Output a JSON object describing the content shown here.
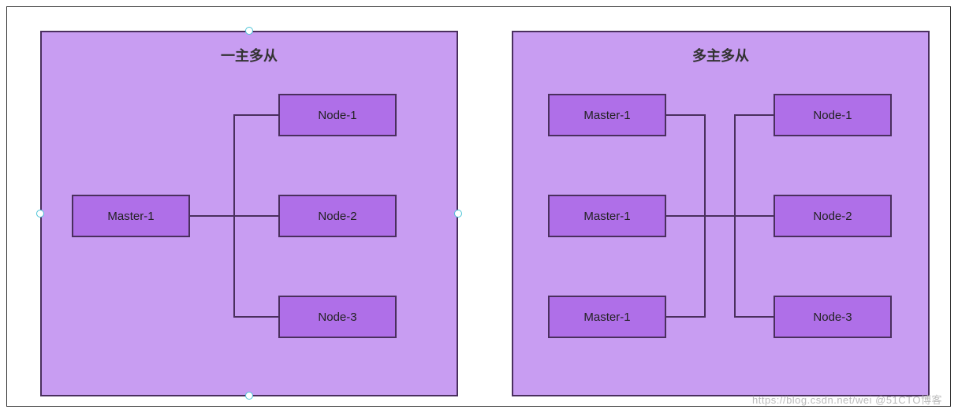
{
  "panels": {
    "left": {
      "title": "一主多从",
      "master": "Master-1",
      "nodes": [
        "Node-1",
        "Node-2",
        "Node-3"
      ]
    },
    "right": {
      "title": "多主多从",
      "masters": [
        "Master-1",
        "Master-1",
        "Master-1"
      ],
      "nodes": [
        "Node-1",
        "Node-2",
        "Node-3"
      ]
    }
  },
  "watermark": "https://blog.csdn.net/wei @51CTO博客"
}
